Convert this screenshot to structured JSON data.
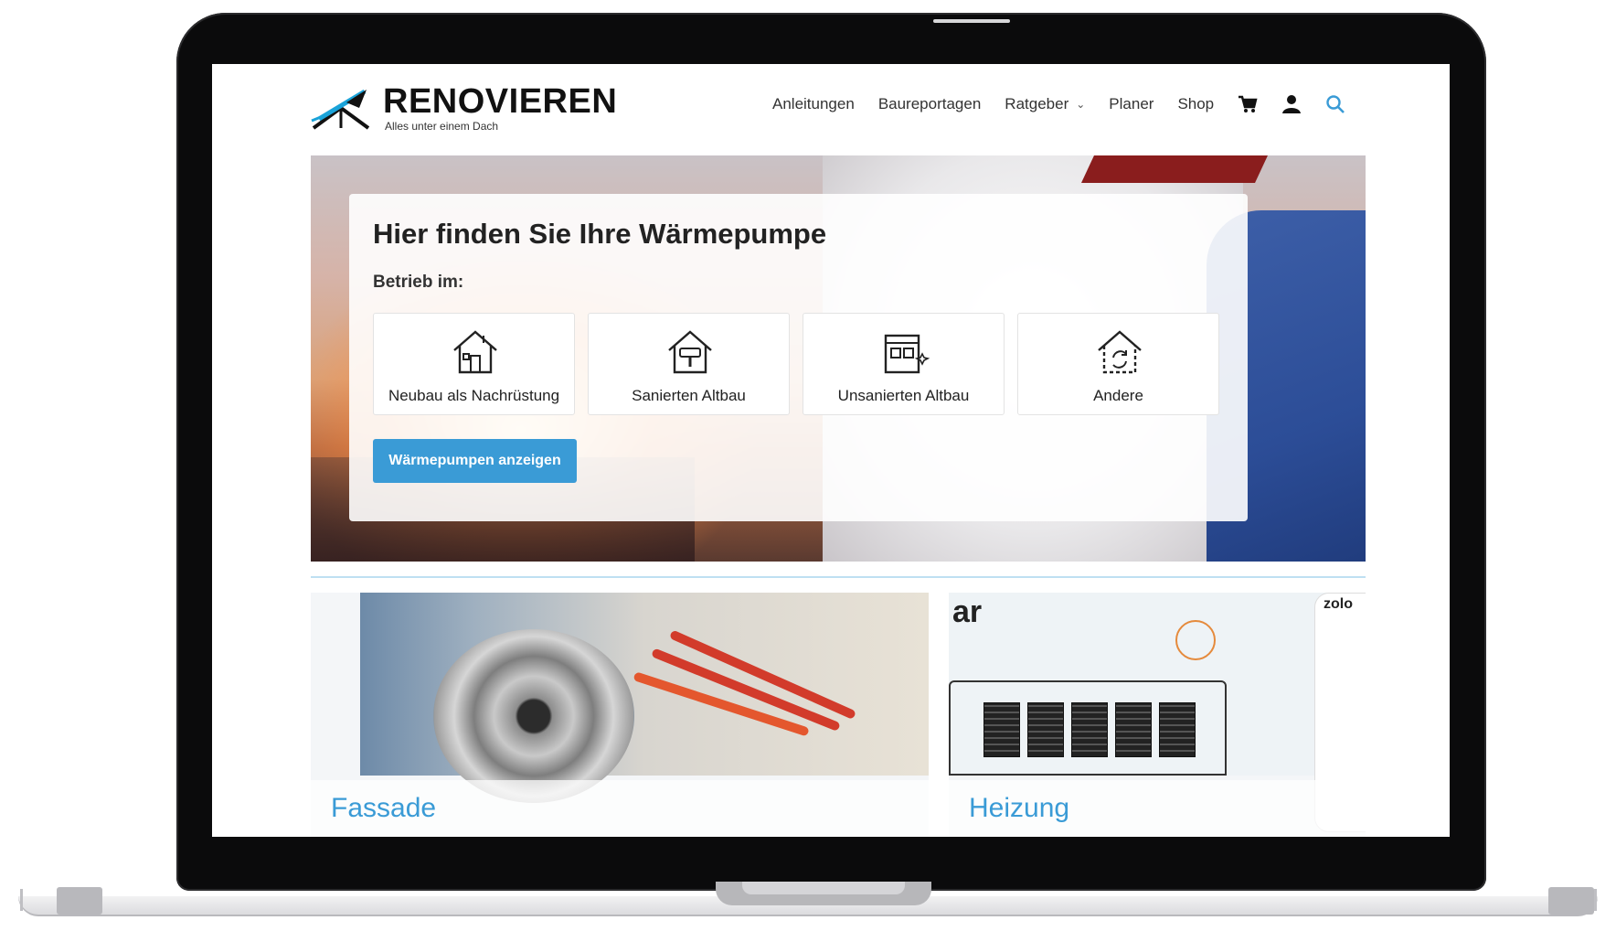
{
  "brand": {
    "name": "RENOVIEREN",
    "tagline": "Alles unter einem Dach",
    "accent": "#3a9bd6"
  },
  "nav": {
    "items": [
      {
        "label": "Anleitungen"
      },
      {
        "label": "Baureportagen"
      },
      {
        "label": "Ratgeber",
        "has_dropdown": true
      },
      {
        "label": "Planer"
      },
      {
        "label": "Shop"
      }
    ],
    "icons": [
      "cart-icon",
      "user-icon",
      "search-icon"
    ]
  },
  "hero": {
    "title": "Hier finden Sie Ihre Wärmepumpe",
    "subtitle": "Betrieb im:",
    "options": [
      {
        "label": "Neubau als Nachrüstung",
        "icon": "house-new-icon"
      },
      {
        "label": "Sanierten Altbau",
        "icon": "house-renovated-icon"
      },
      {
        "label": "Unsanierten Altbau",
        "icon": "house-unrenovated-icon"
      },
      {
        "label": "Andere",
        "icon": "house-other-icon"
      }
    ],
    "cta_label": "Wärmepumpen anzeigen"
  },
  "categories": [
    {
      "label": "Fassade"
    },
    {
      "label": "Heizung"
    }
  ],
  "tile_overlays": {
    "heizung_brand_fragment": "ar",
    "app_fragment": "zolo"
  }
}
